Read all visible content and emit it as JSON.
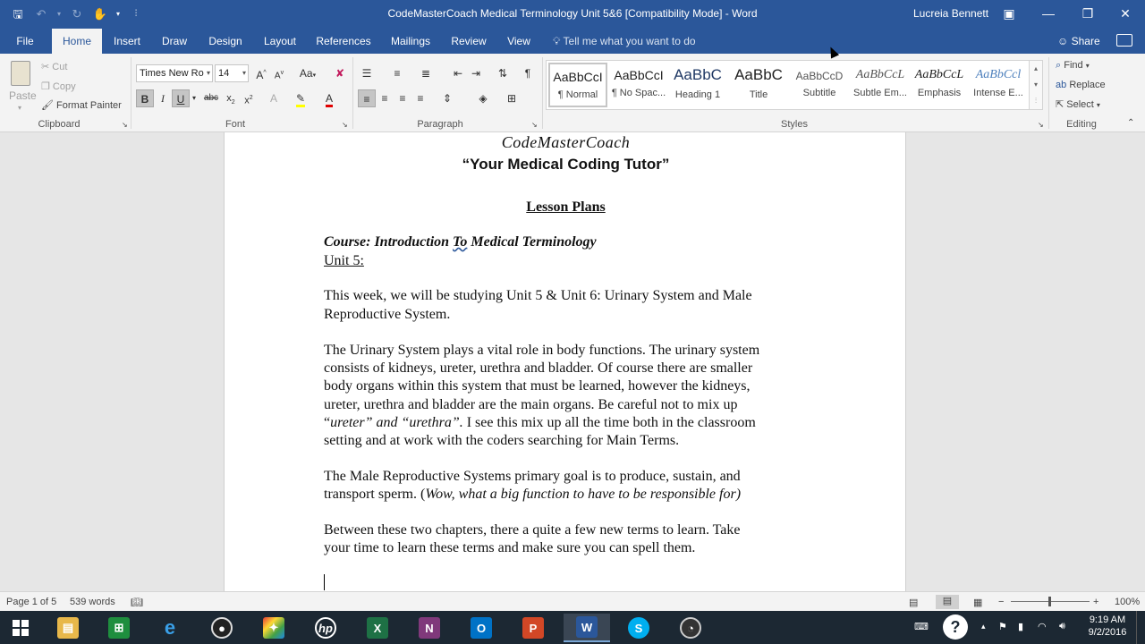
{
  "titlebar": {
    "document_title": "CodeMasterCoach Medical Terminology Unit 5&6 [Compatibility Mode] - Word",
    "user": "Lucreia Bennett"
  },
  "tabs": [
    "File",
    "Home",
    "Insert",
    "Draw",
    "Design",
    "Layout",
    "References",
    "Mailings",
    "Review",
    "View"
  ],
  "active_tab": "Home",
  "tell_me": "Tell me what you want to do",
  "share_label": "Share",
  "clipboard": {
    "paste": "Paste",
    "cut": "Cut",
    "copy": "Copy",
    "format_painter": "Format Painter",
    "label": "Clipboard"
  },
  "font": {
    "name": "Times New Ro",
    "size": "14",
    "label": "Font"
  },
  "paragraph": {
    "label": "Paragraph"
  },
  "styles": {
    "label": "Styles",
    "items": [
      {
        "preview": "AaBbCcI",
        "name": "¶ Normal"
      },
      {
        "preview": "AaBbCcI",
        "name": "¶ No Spac..."
      },
      {
        "preview": "AaBbC",
        "name": "Heading 1"
      },
      {
        "preview": "AaBbC",
        "name": "Title"
      },
      {
        "preview": "AaBbCcD",
        "name": "Subtitle"
      },
      {
        "preview": "AaBbCcL",
        "name": "Subtle Em..."
      },
      {
        "preview": "AaBbCcL",
        "name": "Emphasis"
      },
      {
        "preview": "AaBbCcl",
        "name": "Intense E..."
      }
    ]
  },
  "editing": {
    "find": "Find",
    "replace": "Replace",
    "select": "Select",
    "label": "Editing"
  },
  "document": {
    "logo": "CodeMasterCoach",
    "tagline": "“Your Medical Coding Tutor”",
    "heading": "Lesson Plans",
    "course_prefix": "Course:  Introduction ",
    "course_to": "To",
    "course_suffix": " Medical Terminology",
    "unit": "Unit 5:",
    "p1_l1": "This week, we will be studying Unit 5 & Unit 6:  Urinary System and Male",
    "p1_l2": "Reproductive System.",
    "p2_l1": "The Urinary System plays a vital role in body functions.  The urinary system",
    "p2_l2": "consists of kidneys, ureter, urethra and bladder.  Of course there are smaller",
    "p2_l3": "body organs within this system that must be learned, however the kidneys,",
    "p2_l4": "ureter, urethra and bladder are the main organs.  Be careful not to mix up",
    "p2_l5_a": "“",
    "p2_l5_b": "ureter” and “urethra”.",
    "p2_l5_c": "  I see this mix up all the time both in the classroom",
    "p2_l6": "setting and at work with the coders searching for Main Terms.",
    "p3_l1": "The Male Reproductive Systems primary goal is to produce, sustain, and",
    "p3_l2_a": "transport sperm. (",
    "p3_l2_b": "Wow, what a big function to have to be responsible for)",
    "p4_l1": "Between these two chapters, there a quite a few new terms to learn.  Take",
    "p4_l2": "your time to learn these terms and make sure you can spell them."
  },
  "statusbar": {
    "page": "Page 1 of 5",
    "words": "539 words",
    "zoom": "100%"
  },
  "taskbar": {
    "time": "9:19 AM",
    "date": "9/2/2016"
  }
}
